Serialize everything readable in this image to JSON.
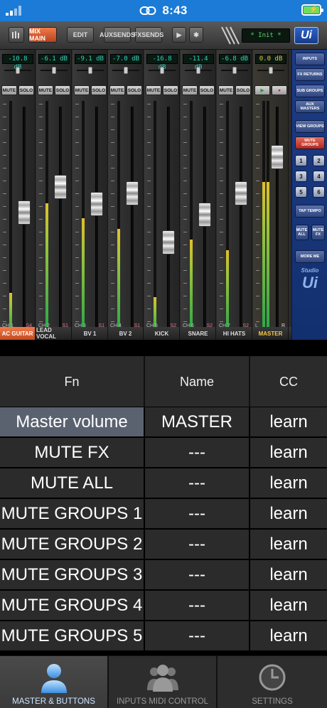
{
  "status_bar": {
    "time": "8:43",
    "link_icon": "link-icon",
    "battery_icon": "battery-charging-icon",
    "signal_icon": "signal-icon"
  },
  "mixer": {
    "topbar": {
      "mix_main": "MIX MAIN",
      "edit": "EDIT",
      "aux_sends": "AUXSENDS",
      "fx_sends": "FXSENDS",
      "lcd": "* Init *",
      "logo": "Ui"
    },
    "channels": [
      {
        "gain": "-10.8 dB",
        "ch": "CH 1",
        "group": "S4",
        "name": "AC GUITAR",
        "fader": 0.56,
        "meter": 0.2,
        "selected": true
      },
      {
        "gain": "-6.1 dB",
        "ch": "CH 2",
        "group": "S1",
        "name": "LEAD VOCAL",
        "fader": 0.68,
        "meter": 0.62
      },
      {
        "gain": "-9.1 dB",
        "ch": "CH 3",
        "group": "S1",
        "name": "BV 1",
        "fader": 0.6,
        "meter": 0.55
      },
      {
        "gain": "-7.0 dB",
        "ch": "CH 4",
        "group": "S1",
        "name": "BV 2",
        "fader": 0.65,
        "meter": 0.5
      },
      {
        "gain": "-16.8 dB",
        "ch": "CH 5",
        "group": "S2",
        "name": "KICK",
        "fader": 0.42,
        "meter": 0.18
      },
      {
        "gain": "-11.4 dB",
        "ch": "CH 6",
        "group": "S2",
        "name": "SNARE",
        "fader": 0.55,
        "meter": 0.45
      },
      {
        "gain": "-6.8 dB",
        "ch": "CH 7",
        "group": "S2",
        "name": "HI HATS",
        "fader": 0.65,
        "meter": 0.4
      }
    ],
    "master": {
      "gain": "0.0 dB",
      "label_l": "L",
      "label_r": "R",
      "name": "MASTER",
      "fader": 0.82,
      "meter": 0.72
    },
    "mute_label": "MUTE",
    "solo_label": "SOLO",
    "right_panel": {
      "inputs": "INPUTS",
      "fx_returns": "FX RETURNS",
      "sub_groups": "SUB GROUPS",
      "aux_masters": "AUX MASTERS",
      "view_groups": "VIEW GROUPS",
      "mute_groups": "MUTE GROUPS",
      "numbers": [
        "1",
        "2",
        "3",
        "4",
        "5",
        "6"
      ],
      "tap_tempo": "TAP TEMPO",
      "mute_all": "MUTE ALL",
      "mute_fx": "MUTE FX",
      "more_me": "MORE ME",
      "brand_small": "Studio",
      "brand_big": "Ui"
    }
  },
  "table": {
    "headers": [
      "Fn",
      "Name",
      "CC"
    ],
    "rows": [
      {
        "fn": "Master volume",
        "name": "MASTER",
        "cc": "learn",
        "highlight": true
      },
      {
        "fn": "MUTE FX",
        "name": "---",
        "cc": "learn"
      },
      {
        "fn": "MUTE ALL",
        "name": "---",
        "cc": "learn"
      },
      {
        "fn": "MUTE GROUPS 1",
        "name": "---",
        "cc": "learn"
      },
      {
        "fn": "MUTE GROUPS 2",
        "name": "---",
        "cc": "learn"
      },
      {
        "fn": "MUTE GROUPS 3",
        "name": "---",
        "cc": "learn"
      },
      {
        "fn": "MUTE GROUPS 4",
        "name": "---",
        "cc": "learn"
      },
      {
        "fn": "MUTE GROUPS 5",
        "name": "---",
        "cc": "learn"
      }
    ]
  },
  "nav": {
    "tabs": [
      {
        "label": "MASTER & BUTTONS",
        "icon": "person-icon",
        "active": true
      },
      {
        "label": "INPUTS MIDI CONTROL",
        "icon": "group-icon"
      },
      {
        "label": "SETTINGS",
        "icon": "clock-icon"
      }
    ]
  }
}
